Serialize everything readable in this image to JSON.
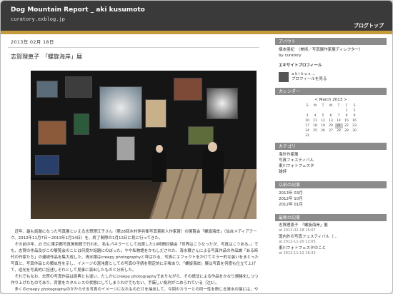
{
  "header": {
    "title": "Dog Mountain Report _ aki kusumoto",
    "url": "curatory.exblog.jp",
    "top_link": "ブログトップ"
  },
  "post": {
    "date": "2013年 02月 18日",
    "title": "志賀理恵子　「螺旋海岸」展",
    "paragraphs": [
      "　近年、最も話題になった写真展といえる志賀理江子さん（第28回木村伊兵衛写真賞新人作家賞）の展覧会「螺旋海岸」（仙台メディアテーク、2012年11月7日〜2013年1月14日）を、終了間際の1月13日に見に行ってきた。",
      "　その前の年、Zl 日に東京都写真美術館で行われ、私もパネラーとして出席した10時間討論会「世界はこうなったが、写真はこうある。」でも、志賀の作品及びこの展覧会のことは何度か話題にのぼった。やや私物語をかもしだされた、清水穣さんによる写真作品の作品論「ある時代の作家たち」の連続作品を集大成した、清水穣はcreepy photographyと呼ばれる、写真にエフェクトをかけてホラー的な装いをまとった写真と、写真作品との類似性を示し、イメージの混沌度としての写真の手続を限定的に示唆あり、「螺旋海岸」展は写真を何度も仕立て上げて、逆光を写真的に記述しそれとして見事に演出したものと分析した。",
      "　それでもなお、志賀の写真作品は原典とも違い、たしかにcreepy photographyでありながら、その語法による作品をかなり規格化しつつ作り上げたものであり、背景をカタルシスの状態にしてしまうわけでもない、手厳しい批判がこめられている（注1）。",
      "　多くのcreepy photographyのかからせる写真のイメージになれものだけを抽出して、今回のカラーとの同一性を断じる清水の論には、やや強引なものを感じる。志賀の写真展は、光にまつわる作品ではあるがcreepy photographyと同系列とされるような「流れる光」(エクトプラズム、幽体、亡霊不明の光、血、体液など)、「部分的身体（切り離された手、身体のありない箇所で突出する部位）」、「正体不明（"
    ],
    "photo_alt": "螺旋海岸展 会場写真"
  },
  "sidebar": {
    "about_heading": "アバウト",
    "about_text": "楠本亜紀　（美術／写真展作家展ディレクター）",
    "about_by": "by curatory",
    "profile_heading": "エキサイトプロフィール",
    "profile_name": "a k i k u s ...",
    "profile_link": "プロフィールを見る",
    "calendar_heading": "カレンダー",
    "calendar_month": "< March 2013 >",
    "calendar_days": [
      "S",
      "M",
      "T",
      "W",
      "T",
      "F",
      "S"
    ],
    "calendar_weeks": [
      [
        "",
        "",
        "",
        "",
        "",
        "1",
        "2"
      ],
      [
        "3",
        "4",
        "5",
        "6",
        "7",
        "8",
        "9"
      ],
      [
        "10",
        "11",
        "12",
        "13",
        "14",
        "15",
        "16"
      ],
      [
        "17",
        "18",
        "19",
        "20",
        "21",
        "22",
        "23"
      ],
      [
        "24",
        "25",
        "26",
        "27",
        "28",
        "29",
        "30"
      ],
      [
        "31",
        "",
        "",
        "",
        "",
        "",
        ""
      ]
    ],
    "calendar_today": "21",
    "category_heading": "カテゴリ",
    "categories": [
      "海外作家展",
      "写真フェスティバル",
      "東川フォトフェスタ",
      "雑評"
    ],
    "archive_heading": "以前の記事",
    "archives": [
      "2013年 03月",
      "2012年 10月",
      "2012年 01月"
    ],
    "recent_heading": "最新の記事",
    "recent": [
      {
        "title": "志賀理恵子　「螺旋海岸」展",
        "date": "at 2013-02-18 15:07"
      },
      {
        "title": "国内外の写真フェスティバル（...",
        "date": "at 2012-11-20 12:05"
      },
      {
        "title": "東川フォトフェスタのこと",
        "date": "at 2012-11-12 16:33"
      }
    ]
  }
}
